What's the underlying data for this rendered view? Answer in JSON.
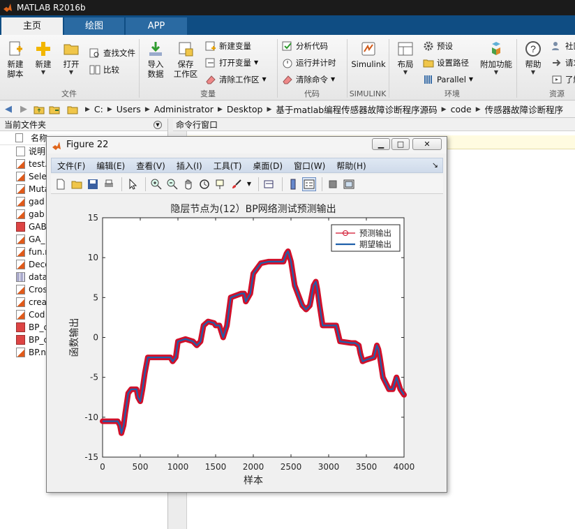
{
  "app": {
    "title": "MATLAB R2016b"
  },
  "tabs": [
    {
      "label": "主页",
      "active": true
    },
    {
      "label": "绘图",
      "active": false
    },
    {
      "label": "APP",
      "active": false
    }
  ],
  "ribbon": {
    "file_group": {
      "label": "文件",
      "new_script": "新建\n脚本",
      "new": "新建",
      "open": "打开",
      "find_files": "查找文件",
      "compare": "比较"
    },
    "variable_group": {
      "label": "变量",
      "import": "导入\n数据",
      "save_ws": "保存\n工作区",
      "new_var": "新建变量",
      "open_var": "打开变量",
      "clear_ws": "清除工作区"
    },
    "code_group": {
      "label": "代码",
      "analyze": "分析代码",
      "run_time": "运行并计时",
      "clear_cmd": "清除命令"
    },
    "simulink_group": {
      "label": "SIMULINK",
      "simulink": "Simulink"
    },
    "env_group": {
      "label": "环境",
      "layout": "布局",
      "prefs": "预设",
      "set_path": "设置路径",
      "parallel": "Parallel",
      "addons": "附加功能"
    },
    "res_group": {
      "label": "资源",
      "help": "帮助",
      "community": "社区",
      "request": "请求",
      "learn": "了解"
    }
  },
  "path": [
    "C:",
    "Users",
    "Administrator",
    "Desktop",
    "基于matlab编程传感器故障诊断程序源码",
    "code",
    "传感器故障诊断程序"
  ],
  "file_panel": {
    "title": "当前文件夹",
    "col_name": "名称",
    "files": [
      {
        "name": "说明",
        "type": "txt"
      },
      {
        "name": "test.",
        "type": "m"
      },
      {
        "name": "Sele",
        "type": "m"
      },
      {
        "name": "Muta",
        "type": "m"
      },
      {
        "name": "gad",
        "type": "m"
      },
      {
        "name": "gab",
        "type": "m"
      },
      {
        "name": "GAB",
        "type": "fig"
      },
      {
        "name": "GA_",
        "type": "m"
      },
      {
        "name": "fun.r",
        "type": "m"
      },
      {
        "name": "Deco",
        "type": "m"
      },
      {
        "name": "data",
        "type": "dat"
      },
      {
        "name": "Cros",
        "type": "m"
      },
      {
        "name": "crea",
        "type": "m"
      },
      {
        "name": "Cod",
        "type": "m"
      },
      {
        "name": "BP_c",
        "type": "fig"
      },
      {
        "name": "BP_c",
        "type": "fig"
      },
      {
        "name": "BP.n",
        "type": "m"
      }
    ]
  },
  "cmd_window": {
    "title": "命令行窗口"
  },
  "figure": {
    "title": "Figure 22",
    "menu": [
      "文件(F)",
      "编辑(E)",
      "查看(V)",
      "插入(I)",
      "工具(T)",
      "桌面(D)",
      "窗口(W)",
      "帮助(H)"
    ]
  },
  "colors": {
    "accent": "#0f4d83",
    "pred": "#d0102a",
    "expected": "#1f5faa"
  },
  "chart_data": {
    "type": "line",
    "title": "隐层节点为(12）BP网络测试预测输出",
    "xlabel": "样本",
    "ylabel": "函数输出",
    "xlim": [
      0,
      4000
    ],
    "ylim": [
      -15,
      15
    ],
    "xticks": [
      0,
      500,
      1000,
      1500,
      2000,
      2500,
      3000,
      3500,
      4000
    ],
    "yticks": [
      15,
      10,
      5,
      0,
      -5,
      -10,
      -15
    ],
    "legend_position": "top-right",
    "grid": false,
    "series": [
      {
        "name": "预测输出",
        "marker": "o",
        "x": [
          0,
          200,
          230,
          250,
          280,
          300,
          340,
          380,
          450,
          470,
          500,
          530,
          560,
          600,
          630,
          700,
          850,
          900,
          930,
          970,
          1000,
          1100,
          1200,
          1250,
          1300,
          1340,
          1400,
          1480,
          1500,
          1550,
          1600,
          1650,
          1700,
          1840,
          1880,
          1900,
          1960,
          2000,
          2100,
          2200,
          2300,
          2400,
          2440,
          2460,
          2500,
          2550,
          2650,
          2700,
          2750,
          2800,
          2830,
          2850,
          2880,
          2920,
          2950,
          3050,
          3100,
          3150,
          3300,
          3350,
          3400,
          3420,
          3450,
          3500,
          3600,
          3640,
          3660,
          3680,
          3720,
          3800,
          3820,
          3850,
          3900,
          3950,
          4000
        ],
        "y": [
          -10.5,
          -10.5,
          -11,
          -12,
          -11,
          -9.5,
          -7,
          -6.5,
          -6.5,
          -7.5,
          -8,
          -6.5,
          -4.5,
          -2.5,
          -2.5,
          -2.5,
          -2.5,
          -2.5,
          -3,
          -2.5,
          -0.5,
          -0.2,
          -0.5,
          -1,
          -0.5,
          1.5,
          2,
          1.8,
          1.5,
          1.5,
          0,
          1.5,
          5,
          5.5,
          5.5,
          4.5,
          5.5,
          8,
          9.3,
          9.5,
          9.5,
          9.5,
          10.5,
          10.8,
          9.5,
          6.5,
          4,
          3.5,
          4,
          6.5,
          7,
          6,
          4,
          1.5,
          1.5,
          1.5,
          1.5,
          -0.5,
          -0.7,
          -0.7,
          -1,
          -2,
          -3,
          -2.8,
          -2.5,
          -1,
          -1.5,
          -2.5,
          -5,
          -6.5,
          -6.5,
          -6.5,
          -5,
          -6.5,
          -7.2
        ]
      },
      {
        "name": "期望输出",
        "marker": "",
        "x": [
          0,
          200,
          230,
          250,
          280,
          300,
          340,
          380,
          450,
          470,
          500,
          530,
          560,
          600,
          630,
          700,
          850,
          900,
          930,
          970,
          1000,
          1100,
          1200,
          1250,
          1300,
          1340,
          1400,
          1480,
          1500,
          1550,
          1600,
          1650,
          1700,
          1840,
          1880,
          1900,
          1960,
          2000,
          2100,
          2200,
          2300,
          2400,
          2440,
          2460,
          2500,
          2550,
          2650,
          2700,
          2750,
          2800,
          2830,
          2850,
          2880,
          2920,
          2950,
          3050,
          3100,
          3150,
          3300,
          3350,
          3400,
          3420,
          3450,
          3500,
          3600,
          3640,
          3660,
          3680,
          3720,
          3800,
          3820,
          3850,
          3900,
          3950,
          4000
        ],
        "y": [
          -10.5,
          -10.5,
          -11,
          -12,
          -11,
          -9.5,
          -7,
          -6.5,
          -6.5,
          -7.5,
          -8,
          -6.5,
          -4.5,
          -2.5,
          -2.5,
          -2.5,
          -2.5,
          -2.5,
          -3,
          -2.5,
          -0.5,
          -0.2,
          -0.5,
          -1,
          -0.5,
          1.5,
          2,
          1.8,
          1.5,
          1.5,
          0,
          1.5,
          5,
          5.5,
          5.5,
          4.5,
          5.5,
          8,
          9.3,
          9.5,
          9.5,
          9.5,
          10.5,
          10.8,
          9.5,
          6.5,
          4,
          3.5,
          4,
          6.5,
          7,
          6,
          4,
          1.5,
          1.5,
          1.5,
          1.5,
          -0.5,
          -0.7,
          -0.7,
          -1,
          -2,
          -3,
          -2.8,
          -2.5,
          -1,
          -1.5,
          -2.5,
          -5,
          -6.5,
          -6.5,
          -6.5,
          -5,
          -6.5,
          -7.2
        ]
      }
    ]
  }
}
